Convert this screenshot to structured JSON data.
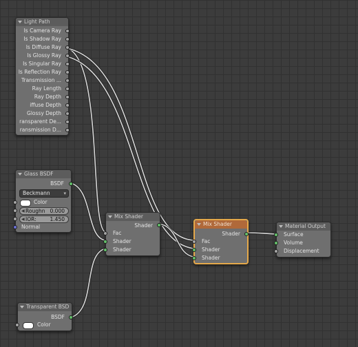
{
  "nodes": {
    "light_path": {
      "title": "Light Path",
      "outputs": [
        "Is Camera Ray",
        "Is Shadow Ray",
        "Is Diffuse Ray",
        "Is Glossy Ray",
        "Is Singular Ray",
        "Is Reflection Ray",
        "Transmission ...",
        "Ray Length",
        "Ray Depth",
        "iffuse Depth",
        "Glossy Depth",
        "ransparent De...",
        "ransmission D..."
      ]
    },
    "glass_bsdf": {
      "title": "Glass BSDF",
      "output": "BSDF",
      "distribution": "Beckmann",
      "color_label": "Color",
      "roughness_label": "Roughn",
      "roughness_value": "0.000",
      "ior_label": "IOR:",
      "ior_value": "1.450",
      "normal_label": "Normal"
    },
    "mix_shader_1": {
      "title": "Mix Shader",
      "output": "Shader",
      "inputs": [
        "Fac",
        "Shader",
        "Shader"
      ]
    },
    "mix_shader_2": {
      "title": "Mix Shader",
      "output": "Shader",
      "inputs": [
        "Fac",
        "Shader",
        "Shader"
      ]
    },
    "material_output": {
      "title": "Material Output",
      "inputs": [
        "Surface",
        "Volume",
        "Displacement"
      ]
    },
    "transparent_bsdf": {
      "title": "Transparent BSD",
      "output": "BSDF",
      "color_label": "Color"
    }
  },
  "colors": {
    "canvas": "#3c3c3c",
    "grid": "#313131",
    "node_body": "#6f6f6f",
    "active_border": "#e6a94a",
    "link": "#d9d9d9",
    "socket_grey": "#a6a6a6",
    "socket_green": "#64c06a",
    "socket_blue": "#6b70d6"
  }
}
